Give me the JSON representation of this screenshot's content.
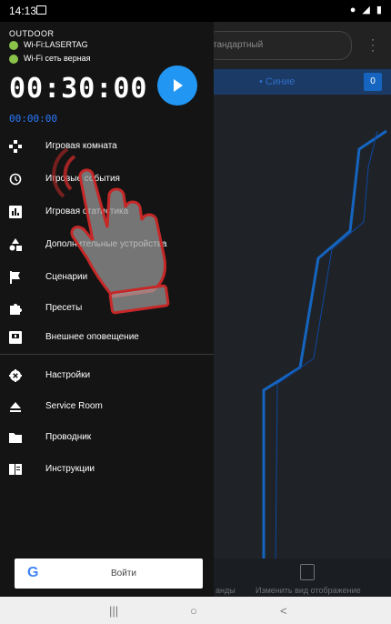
{
  "status_bar": {
    "time": "14:13",
    "right_icons": "● ◢ ▮"
  },
  "app_bg": {
    "mode_field": "тандартный",
    "team_label": "• Синие",
    "team_score": "0",
    "bottom_left": "анды",
    "bottom_right": "Изменить вид отображение"
  },
  "drawer": {
    "mode": "OUTDOOR",
    "wifi_name": "Wi-Fi:LASERTAG",
    "wifi_status": "Wi-Fi сеть верная",
    "main_timer": "00:30:00",
    "sub_timer": "00:00:00",
    "items": [
      {
        "label": "Игровая комната",
        "icon": "gamepad-icon"
      },
      {
        "label": "Игровые события",
        "icon": "history-icon"
      },
      {
        "label": "Игровая статистика",
        "icon": "chart-icon"
      },
      {
        "label": "Дополнительные устройства",
        "icon": "devices-icon"
      },
      {
        "label": "Сценарии",
        "icon": "flag-icon"
      },
      {
        "label": "Пресеты",
        "icon": "puzzle-icon"
      },
      {
        "label": "Внешнее оповещение",
        "icon": "notification-icon"
      }
    ],
    "items2": [
      {
        "label": "Настройки",
        "icon": "gear-icon"
      },
      {
        "label": "Service Room",
        "icon": "eject-icon"
      },
      {
        "label": "Проводник",
        "icon": "folder-icon"
      },
      {
        "label": "Инструкции",
        "icon": "book-icon"
      }
    ],
    "login_label": "Войти"
  },
  "nav": {
    "recents": "|||",
    "home": "○",
    "back": "<"
  },
  "colors": {
    "accent": "#2196f3",
    "drawer_bg": "#141414",
    "wifi_dot": "#8bc34a"
  }
}
